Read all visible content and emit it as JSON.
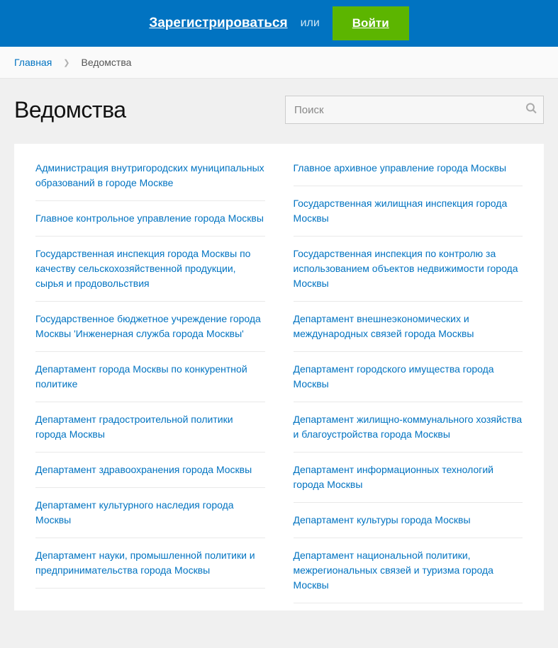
{
  "header": {
    "register": "Зарегистрироваться",
    "or": "или",
    "login": "Войти"
  },
  "breadcrumbs": {
    "home": "Главная",
    "current": "Ведомства"
  },
  "page": {
    "title": "Ведомства"
  },
  "search": {
    "placeholder": "Поиск"
  },
  "departments_left": [
    "Администрация внутригородских муниципальных образований в городе Москве",
    "Главное контрольное управление города Москвы",
    "Государственная инспекция города Москвы по качеству сельскохозяйственной продукции, сырья и продовольствия",
    "Государственное бюджетное учреждение города Москвы 'Инженерная служба города Москвы'",
    "Департамент города Москвы по конкурентной политике",
    "Департамент градостроительной политики города Москвы",
    "Департамент здравоохранения города Москвы",
    "Департамент культурного наследия города Москвы",
    "Департамент науки, промышленной политики и предпринимательства города Москвы"
  ],
  "departments_right": [
    "Главное архивное управление города Москвы",
    "Государственная жилищная инспекция города Москвы",
    "Государственная инспекция по контролю за использованием объектов недвижимости города Москвы",
    "Департамент внешнеэкономических и международных связей города Москвы",
    "Департамент городского имущества города Москвы",
    "Департамент жилищно-коммунального хозяйства и благоустройства города Москвы",
    "Департамент информационных технологий города Москвы",
    "Департамент культуры города Москвы",
    "Департамент национальной политики, межрегиональных связей и туризма города Москвы"
  ]
}
